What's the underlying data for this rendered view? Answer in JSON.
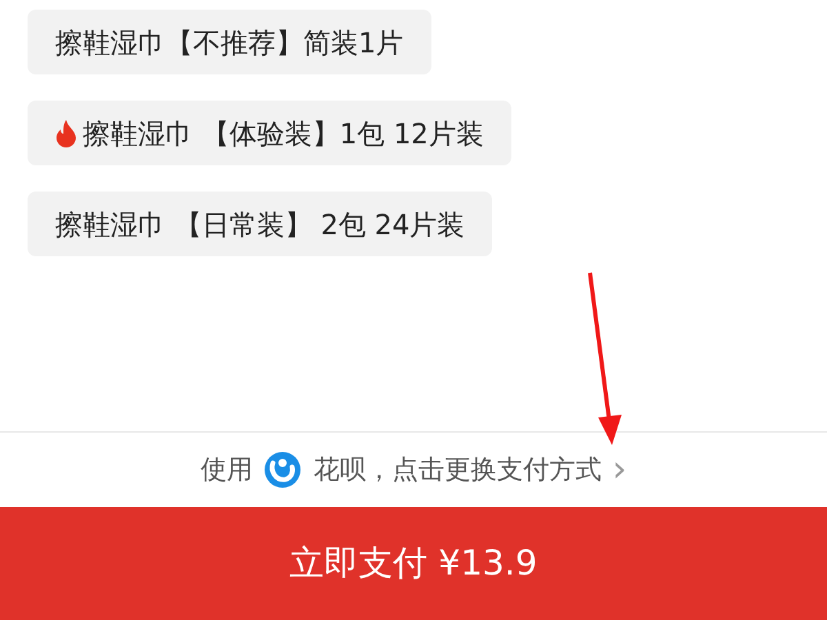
{
  "options": [
    {
      "label": "擦鞋湿巾【不推荐】简装1片",
      "hot": false
    },
    {
      "label": "擦鞋湿巾 【体验装】1包 12片装",
      "hot": true
    },
    {
      "label": "擦鞋湿巾 【日常装】 2包 24片装",
      "hot": false
    }
  ],
  "payment": {
    "prefix": "使用",
    "method": "花呗，点击更换支付方式",
    "chevron": "›"
  },
  "pay_button": "立即支付 ¥13.9"
}
